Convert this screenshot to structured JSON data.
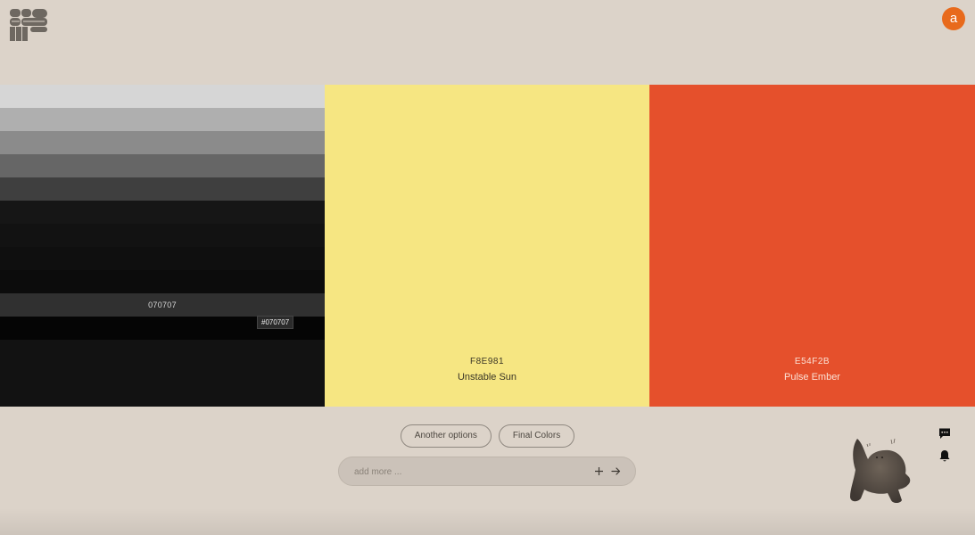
{
  "header": {
    "logo_icon": "brand-logo-icon",
    "avatar_letter": "a",
    "avatar_color": "#e86a1c"
  },
  "palette": {
    "gray_swatch": {
      "shades": [
        "#d6d6d6",
        "#afafaf",
        "#8b8b8b",
        "#666666",
        "#3f3f3f",
        "#161616",
        "#121212",
        "#0f0f0f",
        "#0c0c0c",
        "#303030",
        "#050505"
      ],
      "active_label": "070707",
      "tooltip": "#070707"
    },
    "yellow_swatch": {
      "color": "#f6e682",
      "hex": "F8E981",
      "name": "Unstable Sun"
    },
    "red_swatch": {
      "color": "#e5502c",
      "hex": "E54F2B",
      "name": "Pulse Ember"
    }
  },
  "actions": {
    "another_options_label": "Another options",
    "final_colors_label": "Final Colors"
  },
  "input": {
    "placeholder": "add more ...",
    "value": "",
    "plus_icon": "plus-icon",
    "send_icon": "arrow-right-icon"
  },
  "side": {
    "chat_icon": "chat-bubble-icon",
    "bell_icon": "bell-icon",
    "mascot": "cat-mascot"
  }
}
